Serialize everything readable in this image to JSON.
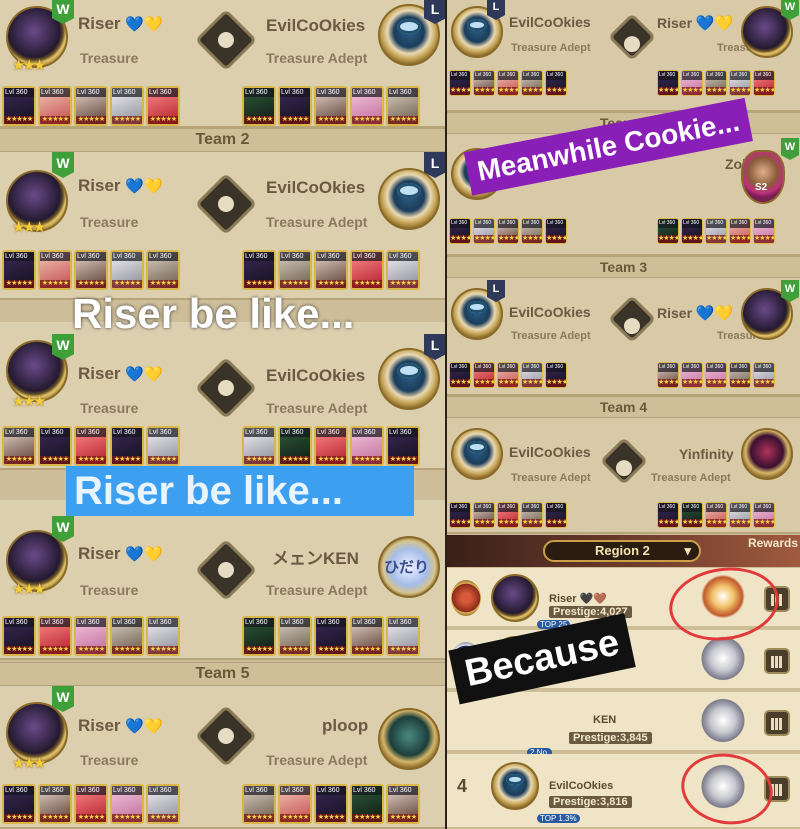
{
  "left_panel": {
    "team2_label": "Team 2",
    "team5_label": "Team 5",
    "matches": [
      {
        "player": "Riser",
        "hearts": "💙💛",
        "rank": "Treasure",
        "opponent": "EvilCoOkies",
        "opponent_rank": "Treasure Adept",
        "result": "W",
        "opp_result": "L"
      },
      {
        "player": "Riser",
        "hearts": "💙💛",
        "rank": "Treasure",
        "opponent": "EvilCoOkies",
        "opponent_rank": "Treasure Adept",
        "result": "W",
        "opp_result": "L"
      },
      {
        "player": "Riser",
        "hearts": "💙💛",
        "rank": "Treasure",
        "opponent": "EvilCoOkies",
        "opponent_rank": "Treasure Adept",
        "result": "W",
        "opp_result": "L"
      },
      {
        "player": "Riser",
        "hearts": "💙💛",
        "rank": "Treasure",
        "opponent": "メェンKEN",
        "opponent_rank": "Treasure Adept",
        "result": "W",
        "opp_avatar_text": "ひだり"
      },
      {
        "player": "Riser",
        "hearts": "💙💛",
        "rank": "Treasure",
        "opponent": "ploop",
        "opponent_rank": "Treasure Adept",
        "result": "W"
      }
    ],
    "hero_level": "Lvl 360"
  },
  "right_panel": {
    "team2_label": "Team 2",
    "team3_label": "Team 3",
    "team4_label": "Team 4",
    "matches": [
      {
        "player": "EvilCoOkies",
        "rank": "Treasure Adept",
        "opponent": "Riser",
        "opponent_hearts": "💙💛",
        "opponent_rank": "Treasure",
        "result": "L",
        "opp_result": "W"
      },
      {
        "player": "Zolbar",
        "opponent_rank": "S2",
        "result": "L",
        "opp_result": "W"
      },
      {
        "player": "EvilCoOkies",
        "rank": "Treasure Adept",
        "opponent": "Riser",
        "opponent_hearts": "💙💛",
        "opponent_rank": "Treasure",
        "result": "L",
        "opp_result": "W"
      },
      {
        "player": "EvilCoOkies",
        "rank": "Treasure Adept",
        "opponent": "Yinfinity",
        "opponent_rank": "Treasure Adept",
        "result": ""
      }
    ],
    "region": {
      "label": "Region 2",
      "rewards": "Rewards",
      "rows": [
        {
          "rank": "",
          "name": "Riser 🖤🤎",
          "prestige": "Prestige:4,027",
          "tag": "TOP 25"
        },
        {
          "rank": "",
          "name": "Zo",
          "prestige": "",
          "tag": ""
        },
        {
          "rank": "",
          "name": "KEN",
          "prestige": "Prestige:3,845",
          "tag": "2 No."
        },
        {
          "rank": "4",
          "name": "EvilCoOkies",
          "prestige": "Prestige:3,816",
          "tag": "TOP 1.3%"
        }
      ]
    }
  },
  "overlays": {
    "riser_be_like_1": "Riser be like...",
    "riser_be_like_2": "Riser be like...",
    "meanwhile": "Meanwhile Cookie...",
    "because": "Because"
  },
  "colors": {
    "win_badge": "#3fa03a",
    "loss_badge": "#2f3a5a",
    "riser_highlight": "#3d9ff0",
    "meanwhile_bg": "#8a1fb8",
    "annotation_circle": "#e23a3a"
  }
}
